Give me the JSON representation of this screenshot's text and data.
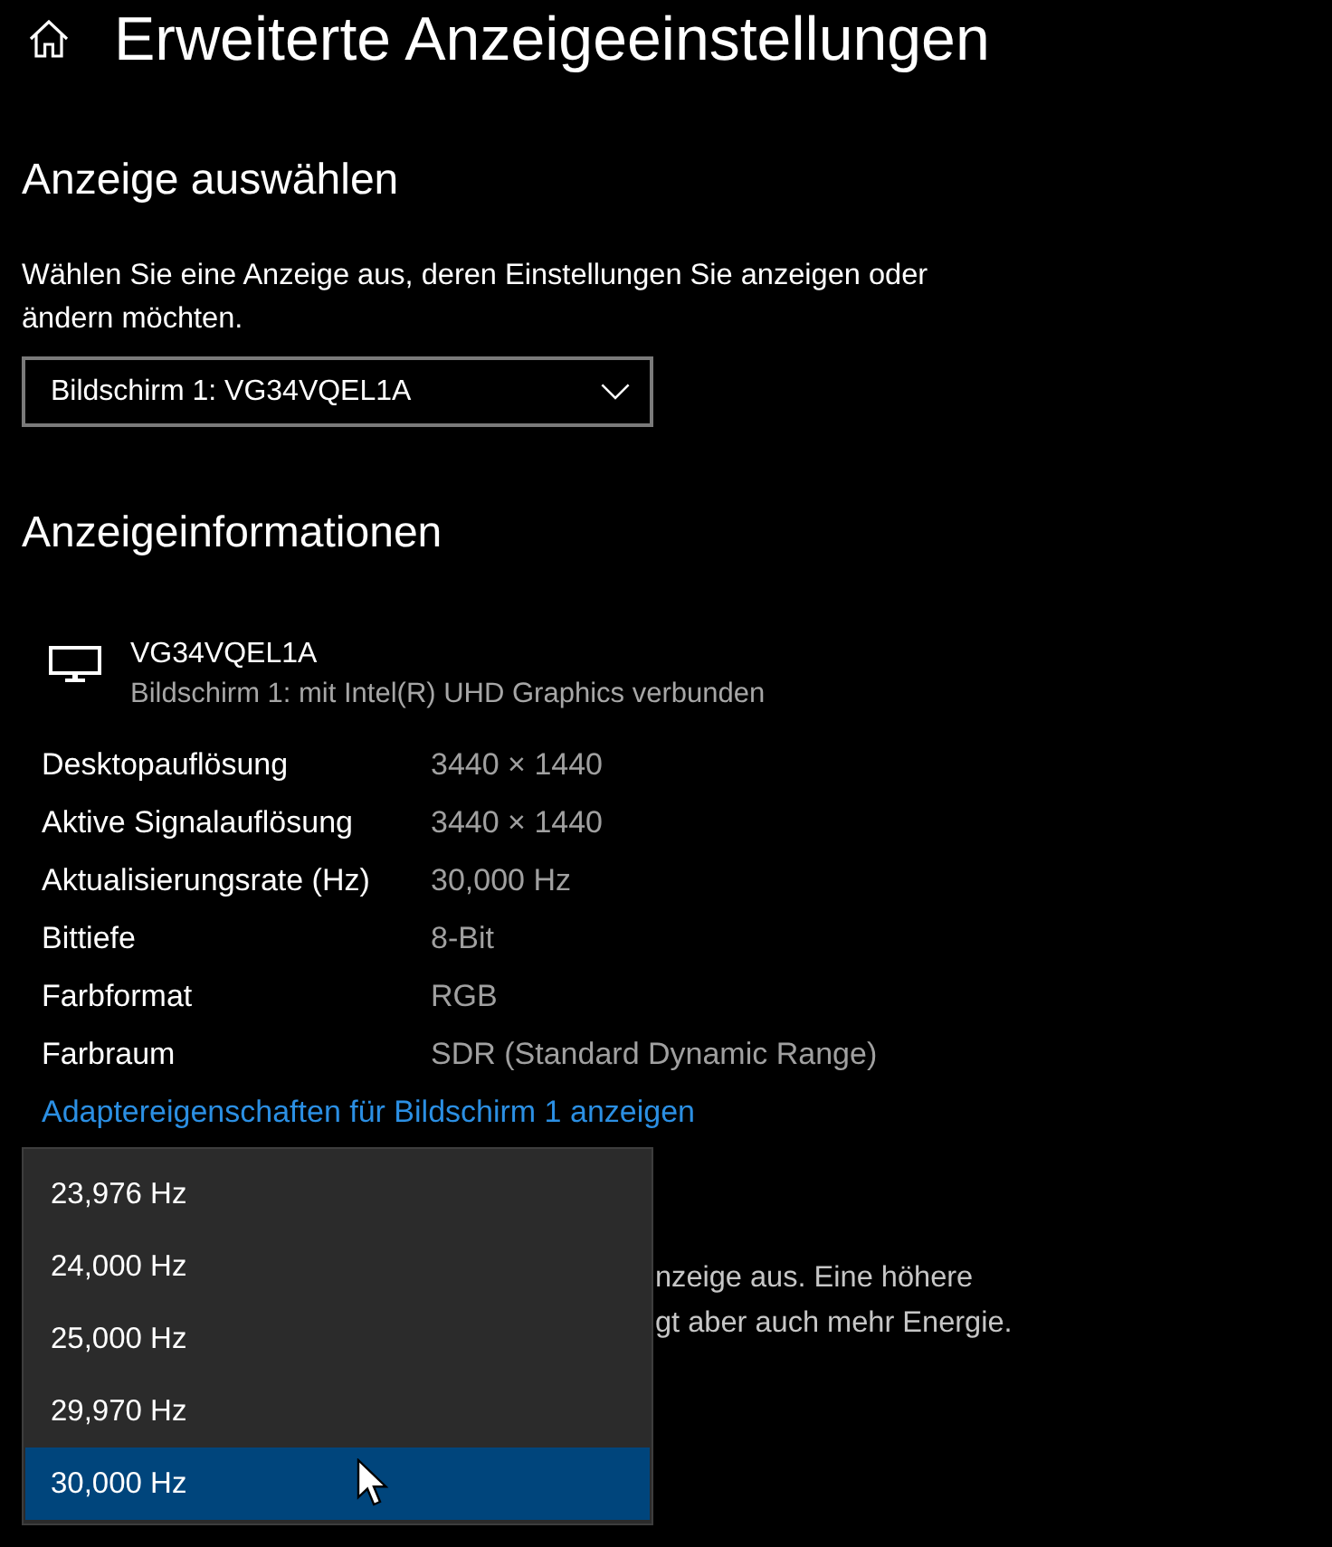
{
  "header": {
    "title": "Erweiterte Anzeigeeinstellungen"
  },
  "display_select": {
    "heading": "Anzeige auswählen",
    "description": "Wählen Sie eine Anzeige aus, deren Einstellungen Sie anzeigen oder ändern möchten.",
    "dropdown": {
      "value": "Bildschirm 1: VG34VQEL1A"
    }
  },
  "display_info": {
    "heading": "Anzeigeinformationen",
    "monitor": {
      "name": "VG34VQEL1A",
      "subtitle": "Bildschirm 1: mit Intel(R) UHD Graphics verbunden"
    },
    "rows": [
      {
        "label": "Desktopauflösung",
        "value": "3440 × 1440"
      },
      {
        "label": "Aktive Signalauflösung",
        "value": "3440 × 1440"
      },
      {
        "label": "Aktualisierungsrate (Hz)",
        "value": "30,000 Hz"
      },
      {
        "label": "Bittiefe",
        "value": "8-Bit"
      },
      {
        "label": "Farbformat",
        "value": "RGB"
      },
      {
        "label": "Farbraum",
        "value": "SDR (Standard Dynamic Range)"
      }
    ],
    "link": "Adaptereigenschaften für Bildschirm 1 anzeigen"
  },
  "refresh_rate": {
    "description_lines": [
      "nzeige aus. Eine höhere",
      "gt aber auch mehr Energie."
    ],
    "menu": {
      "options": [
        {
          "label": "23,976 Hz",
          "selected": false
        },
        {
          "label": "24,000 Hz",
          "selected": false
        },
        {
          "label": "25,000 Hz",
          "selected": false
        },
        {
          "label": "29,970 Hz",
          "selected": false
        },
        {
          "label": "30,000 Hz",
          "selected": true
        }
      ]
    }
  }
}
